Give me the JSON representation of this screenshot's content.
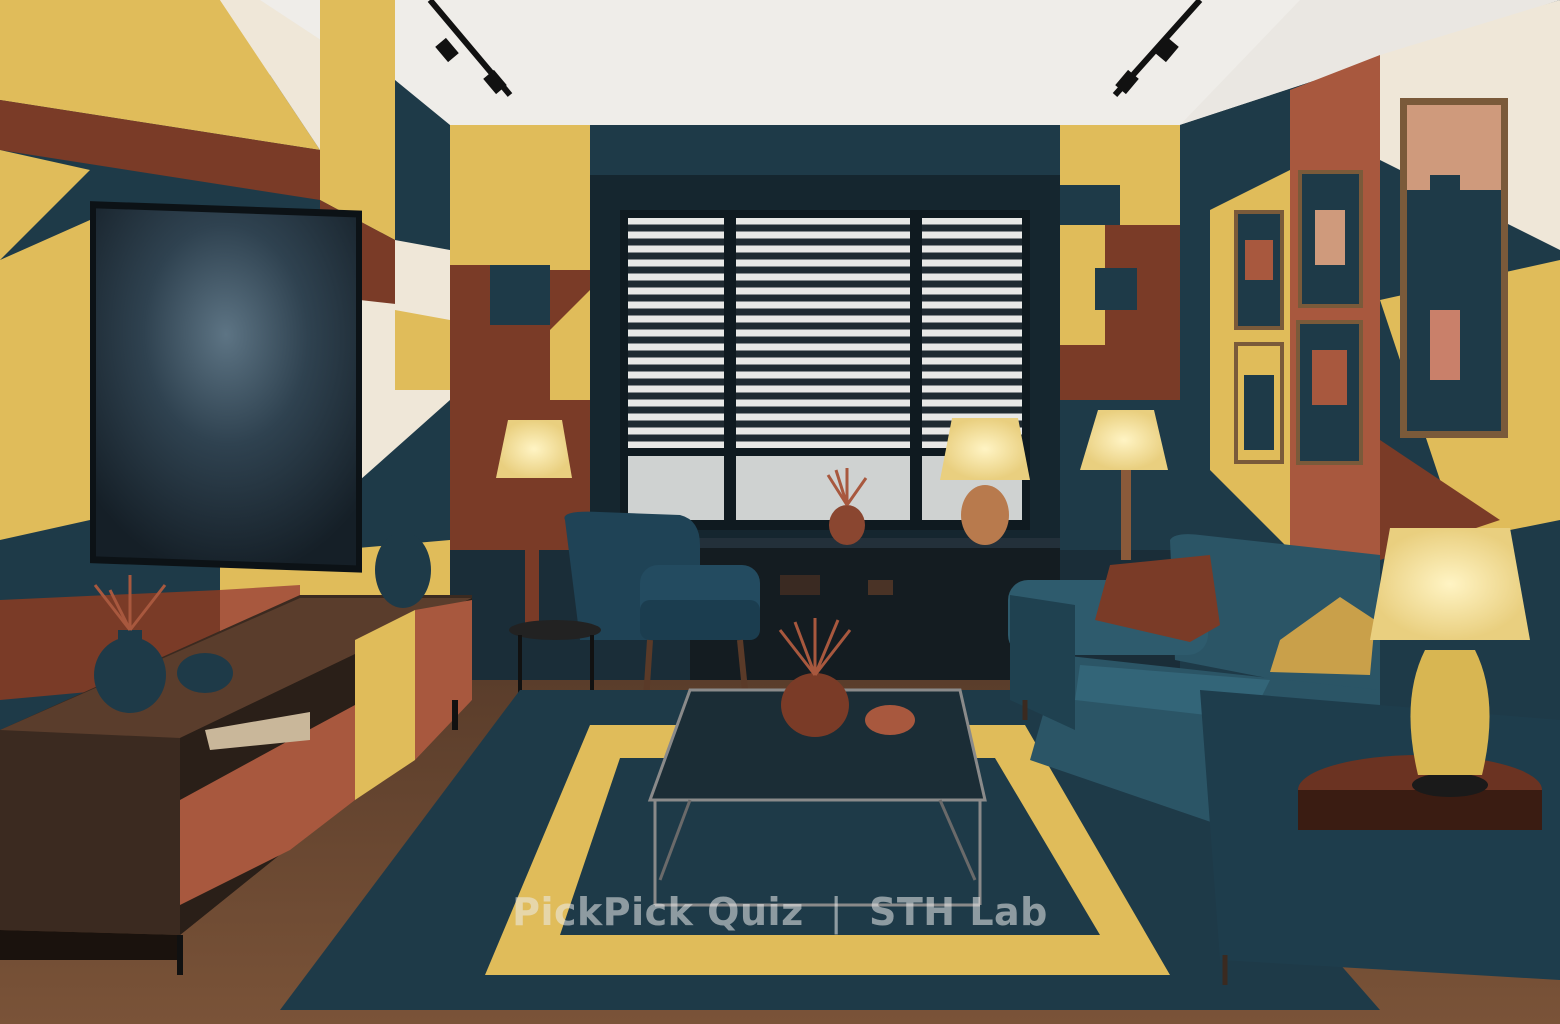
{
  "watermark": {
    "left": "PickPick Quiz",
    "separator": "|",
    "right": "STH Lab"
  },
  "colors": {
    "navy": "#1e3a48",
    "mustard": "#e0bc5a",
    "rust": "#7a3b27",
    "terracotta": "#a8583e",
    "cream": "#efe7d8",
    "floor": "#6b4a33",
    "ceiling": "#eae7e2"
  }
}
